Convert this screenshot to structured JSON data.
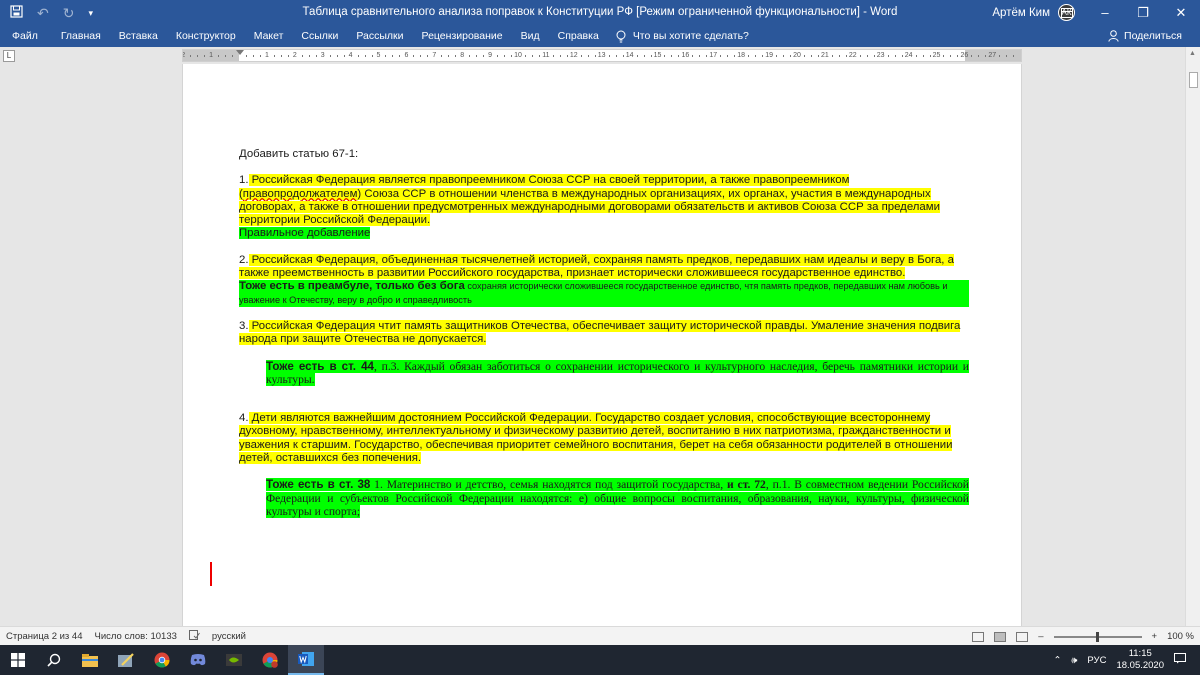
{
  "titlebar": {
    "title": "Таблица сравнительного анализа поправок к Конституции РФ [Режим ограниченной функциональности]  -  Word",
    "user_name": "Артём Ким",
    "avatar_initials": "АК"
  },
  "ribbon": {
    "tabs": [
      "Файл",
      "Главная",
      "Вставка",
      "Конструктор",
      "Макет",
      "Ссылки",
      "Рассылки",
      "Рецензирование",
      "Вид",
      "Справка"
    ],
    "tell_me": "Что вы хотите сделать?",
    "share": "Поделиться"
  },
  "ruler": {
    "corner_label": "L",
    "numbers": [
      "2",
      "1",
      "",
      "1",
      "2",
      "3",
      "4",
      "5",
      "6",
      "7",
      "8",
      "9",
      "10",
      "11",
      "12",
      "13",
      "14",
      "15",
      "16",
      "17",
      "18",
      "19",
      "20",
      "21",
      "22",
      "23",
      "24",
      "25",
      "26",
      "27"
    ]
  },
  "document": {
    "heading": "Добавить статью 67-1:",
    "p1_num": "1.",
    "p1_a": " Российская Федерация является правопреемником Союза ССР на своей территории, а также правопреемником (",
    "p1_misspelled": "правопродолжателем",
    "p1_b": ") Союза ССР в отношении членства в международных организациях, их органах, участия в международных договорах, а также в отношении предусмотренных международными договорами обязательств и активов Союза ССР за пределами территории Российской Федерации.",
    "p1_note": "Правильное добавление",
    "p2_num": "2.",
    "p2_text": " Российская Федерация, объединенная тысячелетней историей, сохраняя память предков, передавших нам идеалы и веру в Бога, а также преемственность в развитии Российского государства, признает исторически сложившееся государственное единство.",
    "p2_note_bold": "Тоже есть в преамбуле, только без бога",
    "p2_note_small": " сохраняя исторически сложившееся государственное единство, чтя память предков, передавших нам любовь и уважение к Отечеству, веру в добро и справедливость",
    "p3_num": "3.",
    "p3_text": " Российская Федерация чтит память защитников Отечества, обеспечивает защиту исторической правды. Умаление значения подвига народа при защите Отечества не допускается.",
    "p3_note_bold": "Тоже есть в ст. 44",
    "p3_note_text": ", п.3. Каждый обязан заботиться о сохранении исторического и культурного наследия, беречь памятники истории и культуры.",
    "p4_num": "4.",
    "p4_text": " Дети являются важнейшим достоянием Российской Федерации. Государство создает условия, способствующие всестороннему духовному, нравственному, интеллектуальному и физическому развитию детей, воспитанию в них патриотизма, гражданственности и уважения к старшим. Государство, обеспечивая приоритет семейного воспитания, берет на себя обязанности родителей в отношении детей, оставшихся без попечения.",
    "p4_note_bold1": "Тоже есть в ст. 38",
    "p4_note_text1": " 1. Материнство и детство, семья находятся под защитой государства, ",
    "p4_note_bold2": "и ст. 72",
    "p4_note_text2": ", п.1. В совместном ведении Российской Федерации и субъектов Российской Федерации находятся: е) общие вопросы воспитания, образования, науки, культуры, физической культуры и спорта;"
  },
  "statusbar": {
    "page": "Страница 2 из 44",
    "words": "Число слов: 10133",
    "language": "русский",
    "zoom_minus": "–",
    "zoom_plus": "+",
    "zoom": "100 %",
    "zoom_level_percent": 100
  },
  "taskbar": {
    "language": "РУС",
    "time": "11:15",
    "date": "18.05.2020"
  },
  "colors": {
    "word_blue": "#2b579a",
    "highlight_yellow": "#ffff00",
    "highlight_green": "#00ff00",
    "taskbar": "#1f2631"
  }
}
